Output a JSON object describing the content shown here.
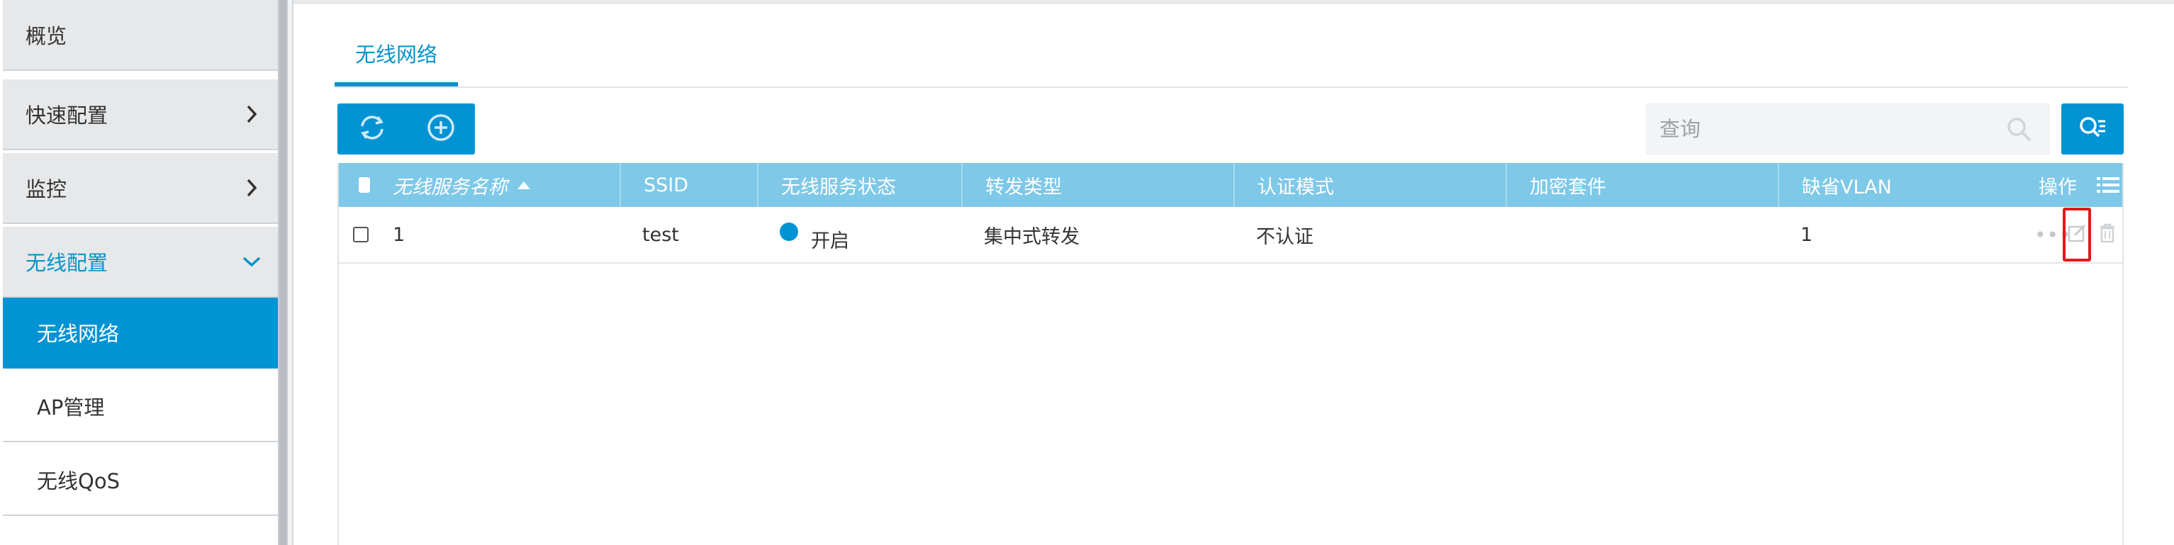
{
  "sidebar": {
    "items": [
      {
        "label": "概览"
      },
      {
        "label": "快速配置"
      },
      {
        "label": "监控"
      },
      {
        "label": "无线配置"
      },
      {
        "label": "无线网络"
      },
      {
        "label": "AP管理"
      },
      {
        "label": "无线QoS"
      }
    ]
  },
  "main": {
    "tabs": [
      {
        "label": "无线网络"
      }
    ],
    "search": {
      "placeholder": "查询"
    },
    "table": {
      "headers": [
        "无线服务名称",
        "SSID",
        "无线服务状态",
        "转发类型",
        "认证模式",
        "加密套件",
        "缺省VLAN",
        "操作"
      ],
      "rows": [
        {
          "name": "1",
          "ssid": "test",
          "status": "开启",
          "forward": "集中式转发",
          "auth": "不认证",
          "cipher": "",
          "vlan": "1",
          "more": "•••"
        }
      ]
    }
  },
  "colors": {
    "accent": "#0193d4",
    "header_bg": "#7ec8e8",
    "highlight": "#e11a1a"
  },
  "icons": [
    "chevron-right-icon",
    "chevron-down-icon",
    "refresh-icon",
    "add-circle-icon",
    "search-icon",
    "advanced-search-icon",
    "column-list-icon",
    "more-icon",
    "edit-icon",
    "delete-icon"
  ]
}
